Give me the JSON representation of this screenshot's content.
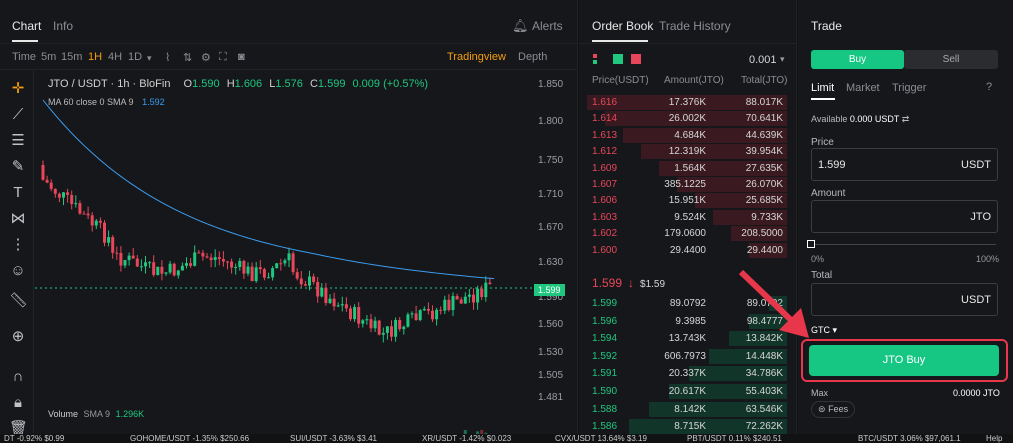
{
  "chart_tabs": {
    "chart": "Chart",
    "info": "Info",
    "alerts": "Alerts"
  },
  "toolbar": {
    "time": "Time",
    "tf": [
      "5m",
      "15m",
      "1H",
      "4H",
      "1D"
    ],
    "tradingview": "Tradingview",
    "depth": "Depth"
  },
  "legend": {
    "symbol": "JTO / USDT · 1h · BloFin",
    "o": "1.590",
    "h": "1.606",
    "l": "1.576",
    "c": "1.599",
    "chg": "0.009 (+0.57%)",
    "ma": "MA 60 close 0 SMA 9",
    "ma_val": "1.592",
    "volume": "Volume",
    "vol_sma": "SMA 9",
    "vol_val": "1.296K"
  },
  "axis": [
    "1.850",
    "1.800",
    "1.750",
    "1.710",
    "1.670",
    "1.630",
    "1.590",
    "1.560",
    "1.530",
    "1.505",
    "1.481"
  ],
  "price_tag": "1.599",
  "chart_data": {
    "type": "candlestick",
    "symbol": "JTO / USDT",
    "interval": "1h",
    "last": 1.599,
    "ma_last": 1.592,
    "y_range": [
      1.481,
      1.85
    ]
  },
  "ticker": [
    "DT -0.92% $0.99",
    "GOHOME/USDT -1.35% $250.66",
    "SUI/USDT -3.63% $3.41",
    "XR/USDT -1.42% $0.023",
    "CVX/USDT 13.64% $3.19",
    "PBT/USDT 0.11% $240.51",
    "BTC/USDT 3.06% $97,061.1"
  ],
  "orderbook": {
    "tab1": "Order Book",
    "tab2": "Trade History",
    "precision": "0.001",
    "h_price": "Price(USDT)",
    "h_amount": "Amount(JTO)",
    "h_total": "Total(JTO)",
    "asks": [
      [
        "1.616",
        "17.376K",
        "88.017K"
      ],
      [
        "1.614",
        "26.002K",
        "70.641K"
      ],
      [
        "1.613",
        "4.684K",
        "44.639K"
      ],
      [
        "1.612",
        "12.319K",
        "39.954K"
      ],
      [
        "1.609",
        "1.564K",
        "27.635K"
      ],
      [
        "1.607",
        "385.1225",
        "26.070K"
      ],
      [
        "1.606",
        "15.951K",
        "25.685K"
      ],
      [
        "1.603",
        "9.524K",
        "9.733K"
      ],
      [
        "1.602",
        "179.0600",
        "208.5000"
      ],
      [
        "1.600",
        "29.4400",
        "29.4400"
      ]
    ],
    "mid": "1.599",
    "mid_alt": "$1.59",
    "bids": [
      [
        "1.599",
        "89.0792",
        "89.0792"
      ],
      [
        "1.596",
        "9.3985",
        "98.4777"
      ],
      [
        "1.594",
        "13.743K",
        "13.842K"
      ],
      [
        "1.592",
        "606.7973",
        "14.448K"
      ],
      [
        "1.591",
        "20.337K",
        "34.786K"
      ],
      [
        "1.590",
        "20.617K",
        "55.403K"
      ],
      [
        "1.588",
        "8.142K",
        "63.546K"
      ],
      [
        "1.586",
        "8.715K",
        "72.262K"
      ]
    ]
  },
  "trade": {
    "title": "Trade",
    "buy": "Buy",
    "sell": "Sell",
    "limit": "Limit",
    "market": "Market",
    "trigger": "Trigger",
    "available": "Available",
    "available_val": "0.000 USDT",
    "price_lbl": "Price",
    "price_val": "1.599",
    "price_unit": "USDT",
    "amount_lbl": "Amount",
    "amount_unit": "JTO",
    "pct0": "0%",
    "pct100": "100%",
    "total_lbl": "Total",
    "total_unit": "USDT",
    "gtc": "GTC",
    "submit": "JTO Buy",
    "max_lbl": "Max",
    "max_val": "0.0000 JTO",
    "fees": "Fees",
    "help": "Help"
  }
}
